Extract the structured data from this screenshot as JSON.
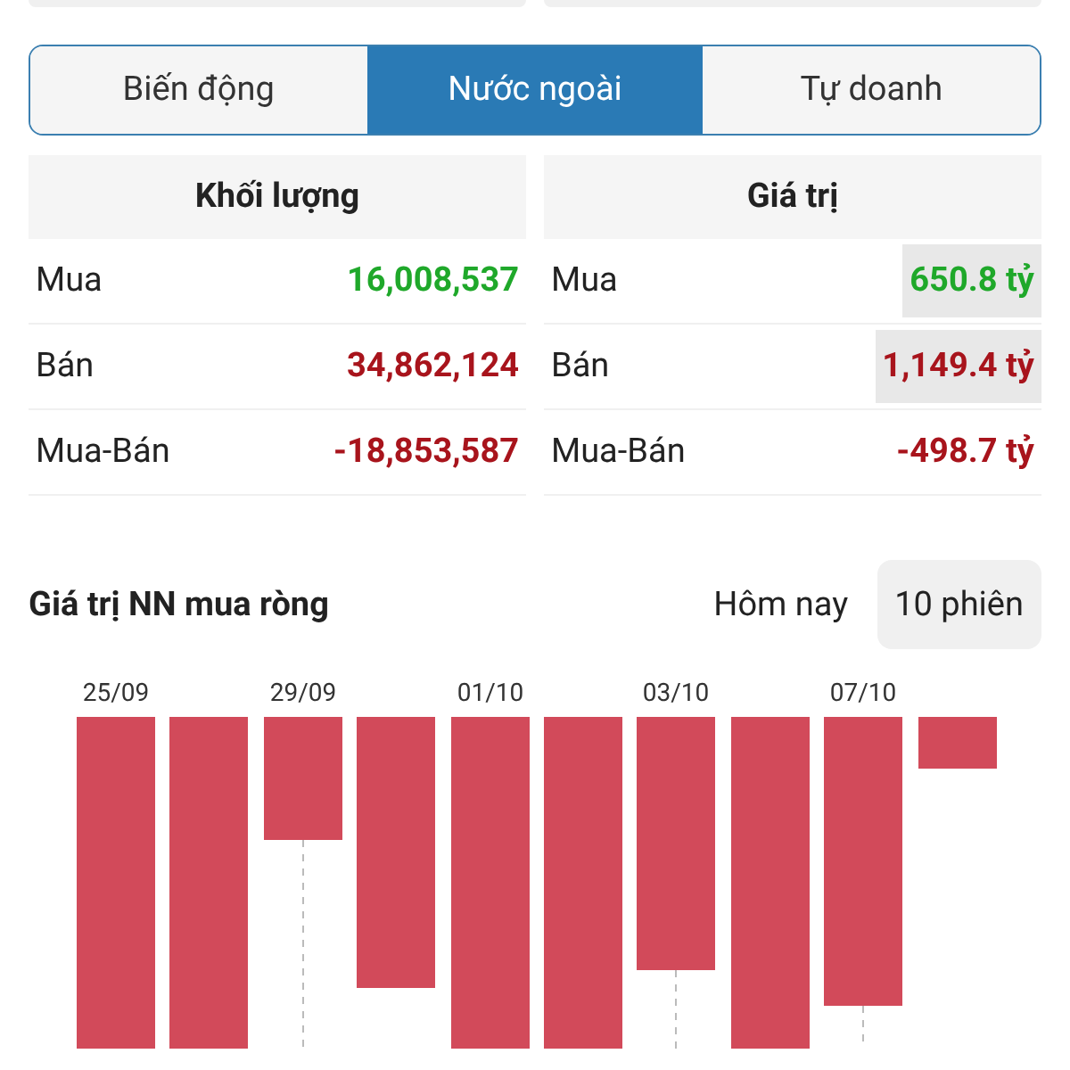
{
  "tabs": [
    {
      "label": "Biến động",
      "selected": false
    },
    {
      "label": "Nước ngoài",
      "selected": true
    },
    {
      "label": "Tự doanh",
      "selected": false
    }
  ],
  "tables": [
    {
      "header": "Khối lượng",
      "rows": [
        {
          "label": "Mua",
          "value": "16,008,537",
          "color": "#1fa82a",
          "highlighted": false
        },
        {
          "label": "Bán",
          "value": "34,862,124",
          "color": "#a8141c",
          "highlighted": false
        },
        {
          "label": "Mua-Bán",
          "value": "-18,853,587",
          "color": "#a8141c",
          "highlighted": false
        }
      ]
    },
    {
      "header": "Giá trị",
      "rows": [
        {
          "label": "Mua",
          "value": "650.8 tỷ",
          "color": "#1fa82a",
          "highlighted": true
        },
        {
          "label": "Bán",
          "value": "1,149.4 tỷ",
          "color": "#a8141c",
          "highlighted": true
        },
        {
          "label": "Mua-Bán",
          "value": "-498.7 tỷ",
          "color": "#a8141c",
          "highlighted": false
        }
      ]
    }
  ],
  "chart": {
    "title": "Giá trị NN mua ròng",
    "periods": [
      {
        "label": "Hôm nay",
        "selected": false
      },
      {
        "label": "10 phiên",
        "selected": true
      }
    ],
    "date_labels": [
      "25/09",
      "29/09",
      "01/10",
      "03/10",
      "07/10"
    ]
  }
}
